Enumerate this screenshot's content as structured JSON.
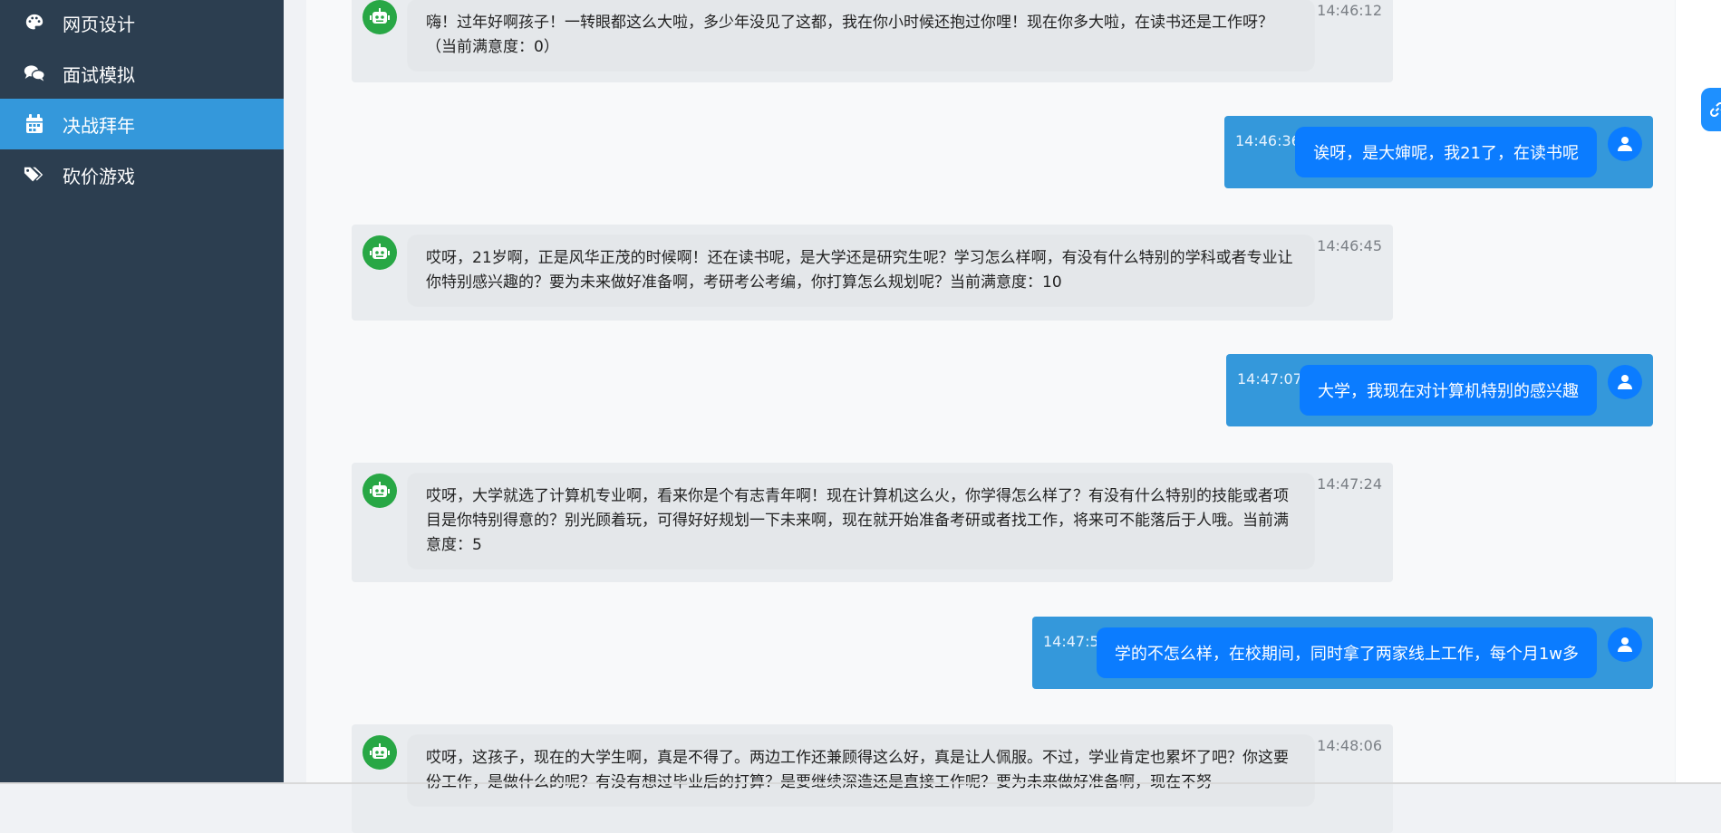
{
  "sidebar": {
    "items": [
      {
        "label": "网页设计",
        "icon": "palette-icon"
      },
      {
        "label": "面试模拟",
        "icon": "comments-icon"
      },
      {
        "label": "决战拜年",
        "icon": "calendar-icon",
        "active": true
      },
      {
        "label": "砍价游戏",
        "icon": "tags-icon"
      }
    ]
  },
  "colors": {
    "sidebar_bg": "#2c3e50",
    "sidebar_active": "#3498db",
    "bot_avatar": "#28a745",
    "user_card": "#3498db",
    "user_bubble": "#0b7cff"
  },
  "chat": {
    "messages": [
      {
        "role": "bot",
        "time": "14:46:12",
        "text": "嗨！过年好啊孩子！一转眼都这么大啦，多少年没见了这都，我在你小时候还抱过你哩！现在你多大啦，在读书还是工作呀？（当前满意度：0）"
      },
      {
        "role": "user",
        "time": "14:46:36",
        "text": "诶呀，是大婶呢，我21了，在读书呢"
      },
      {
        "role": "bot",
        "time": "14:46:45",
        "text": "哎呀，21岁啊，正是风华正茂的时候啊！还在读书呢，是大学还是研究生呢？学习怎么样啊，有没有什么特别的学科或者专业让你特别感兴趣的？要为未来做好准备啊，考研考公考编，你打算怎么规划呢？当前满意度：10"
      },
      {
        "role": "user",
        "time": "14:47:07",
        "text": "大学，我现在对计算机特别的感兴趣"
      },
      {
        "role": "bot",
        "time": "14:47:24",
        "text": "哎呀，大学就选了计算机专业啊，看来你是个有志青年啊！现在计算机这么火，你学得怎么样了？有没有什么特别的技能或者项目是你特别得意的？别光顾着玩，可得好好规划一下未来啊，现在就开始准备考研或者找工作，将来可不能落后于人哦。当前满意度：5"
      },
      {
        "role": "user",
        "time": "14:47:58",
        "text": "学的不怎么样，在校期间，同时拿了两家线上工作，每个月1w多"
      },
      {
        "role": "bot",
        "time": "14:48:06",
        "text": "哎呀，这孩子，现在的大学生啊，真是不得了。两边工作还兼顾得这么好，真是让人佩服。不过，学业肯定也累坏了吧？你这要份工作，是做什么的呢？有没有想过毕业后的打算？是要继续深造还是直接工作呢？要为未来做好准备啊，现在不努"
      }
    ]
  }
}
